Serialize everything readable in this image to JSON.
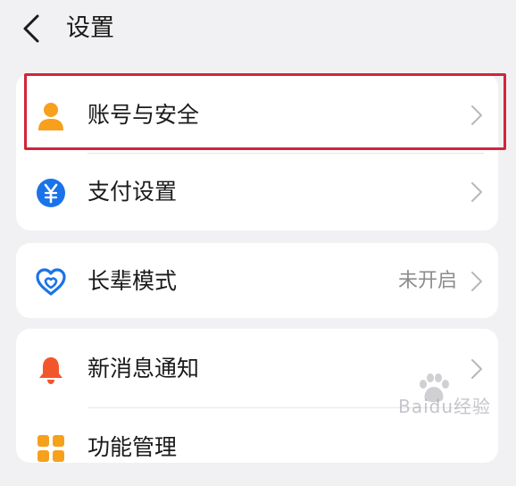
{
  "header": {
    "back_icon": "chevron-left-icon",
    "title": "设置"
  },
  "groups": [
    {
      "items": [
        {
          "label": "账号与安全",
          "icon": "person-icon",
          "icon_color": "#f7a01c"
        },
        {
          "label": "支付设置",
          "icon": "yuan-icon",
          "icon_color": "#1a73e8"
        }
      ]
    },
    {
      "items": [
        {
          "label": "长辈模式",
          "value": "未开启",
          "icon": "heart-icon",
          "icon_color": "#1a73e8"
        }
      ]
    },
    {
      "items": [
        {
          "label": "新消息通知",
          "icon": "bell-icon",
          "icon_color": "#f2572c"
        },
        {
          "label": "功能管理",
          "icon": "grid-icon",
          "icon_color": "#f7a01c"
        }
      ]
    }
  ],
  "highlight_color": "#d0253a",
  "watermark": "Baidu经验"
}
